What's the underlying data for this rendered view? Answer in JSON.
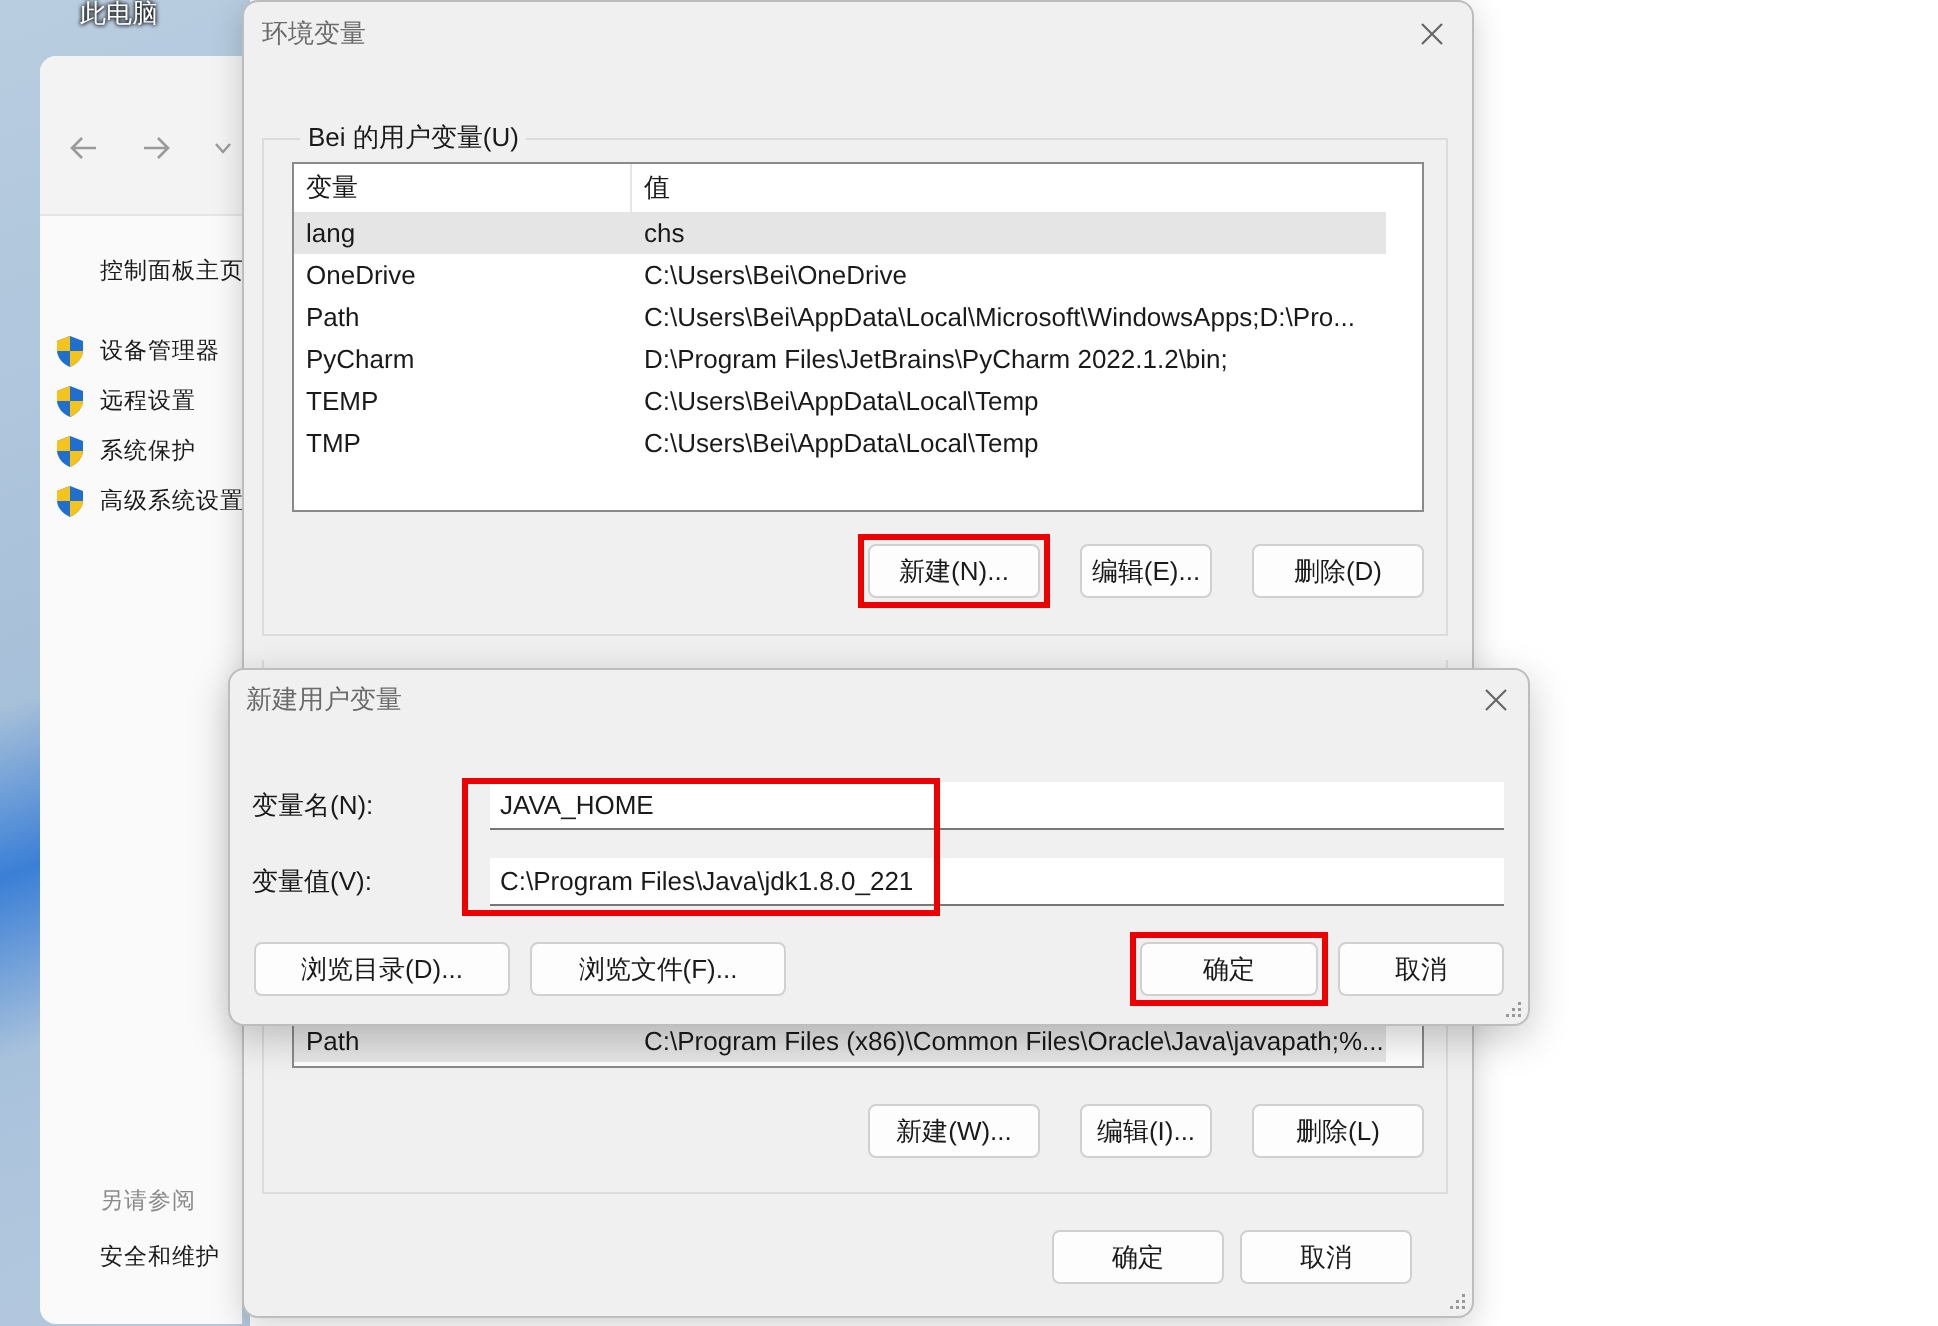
{
  "desktop": {
    "icon_label": "此电脑"
  },
  "system_window": {
    "home_link": "控制面板主页",
    "links": [
      {
        "label": "设备管理器"
      },
      {
        "label": "远程设置"
      },
      {
        "label": "系统保护"
      },
      {
        "label": "高级系统设置"
      }
    ],
    "see_also_title": "另请参阅",
    "see_also": [
      "安全和维护"
    ]
  },
  "env_window": {
    "title": "环境变量",
    "user_group": {
      "title": "Bei 的用户变量(U)",
      "columns": [
        "变量",
        "值"
      ],
      "rows": [
        {
          "name": "lang",
          "value": "chs",
          "selected": true
        },
        {
          "name": "OneDrive",
          "value": "C:\\Users\\Bei\\OneDrive",
          "selected": false
        },
        {
          "name": "Path",
          "value": "C:\\Users\\Bei\\AppData\\Local\\Microsoft\\WindowsApps;D:\\Pro...",
          "selected": false
        },
        {
          "name": "PyCharm",
          "value": "D:\\Program Files\\JetBrains\\PyCharm 2022.1.2\\bin;",
          "selected": false
        },
        {
          "name": "TEMP",
          "value": "C:\\Users\\Bei\\AppData\\Local\\Temp",
          "selected": false
        },
        {
          "name": "TMP",
          "value": "C:\\Users\\Bei\\AppData\\Local\\Temp",
          "selected": false
        }
      ],
      "buttons": [
        {
          "label": "新建(N)...",
          "highlighted": true
        },
        {
          "label": "编辑(E)...",
          "highlighted": false
        },
        {
          "label": "删除(D)",
          "highlighted": false
        }
      ]
    },
    "system_group": {
      "rows": [
        {
          "name": "Path",
          "value": "C:\\Program Files (x86)\\Common Files\\Oracle\\Java\\javapath;%...",
          "selected": true
        }
      ],
      "buttons": [
        {
          "label": "新建(W)...",
          "highlighted": false
        },
        {
          "label": "编辑(I)...",
          "highlighted": false
        },
        {
          "label": "删除(L)",
          "highlighted": false
        }
      ]
    },
    "buttons": [
      {
        "label": "确定",
        "highlighted": false
      },
      {
        "label": "取消",
        "highlighted": false
      }
    ]
  },
  "new_var_dialog": {
    "title": "新建用户变量",
    "fields": [
      {
        "label": "变量名(N):",
        "value": "JAVA_HOME"
      },
      {
        "label": "变量值(V):",
        "value": "C:\\Program Files\\Java\\jdk1.8.0_221"
      }
    ],
    "fields_highlighted": true,
    "browse_buttons": [
      {
        "label": "浏览目录(D)...",
        "highlighted": false
      },
      {
        "label": "浏览文件(F)...",
        "highlighted": false
      }
    ],
    "buttons": [
      {
        "label": "确定",
        "highlighted": true
      },
      {
        "label": "取消",
        "highlighted": false
      }
    ]
  }
}
